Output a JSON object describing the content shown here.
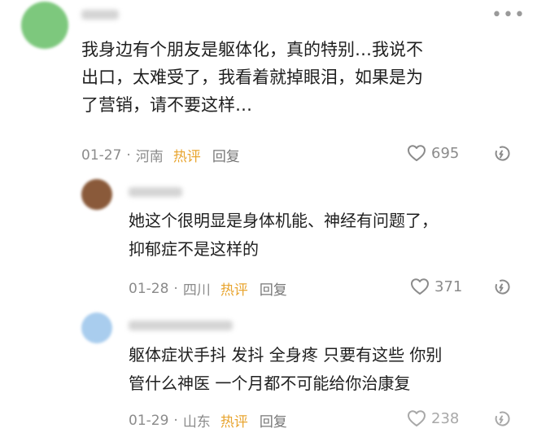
{
  "comments": [
    {
      "text_lines": [
        "我身边有个朋友是躯体化，真的特别…我说不",
        "出口，太难受了，我看着就掉眼泪，如果是为",
        "了营销，请不要这样…"
      ],
      "date": "01-27",
      "location": "河南",
      "tag": "热评",
      "reply_label": "回复",
      "likes": "695",
      "more_icon": "more-dots-icon",
      "like_icon": "heart-icon",
      "share_icon": "share-icon",
      "avatar_color": "#7dc87d"
    }
  ],
  "replies": [
    {
      "text_lines": [
        "她这个很明显是身体机能、神经有问题了，",
        "抑郁症不是这样的"
      ],
      "date": "01-28",
      "location": "四川",
      "tag": "热评",
      "reply_label": "回复",
      "likes": "371",
      "avatar_color": "#8a5a3a"
    },
    {
      "text_lines": [
        "躯体症状手抖 发抖 全身疼 只要有这些 你别",
        "管什么神医 一个月都不可能给你治康复"
      ],
      "date": "01-29",
      "location": "山东",
      "tag": "热评",
      "reply_label": "回复",
      "likes": "238",
      "avatar_color": "#a9cdee"
    }
  ],
  "separator": "·",
  "colors": {
    "hot_tag": "#e8a530",
    "meta": "#8b8b8b"
  }
}
